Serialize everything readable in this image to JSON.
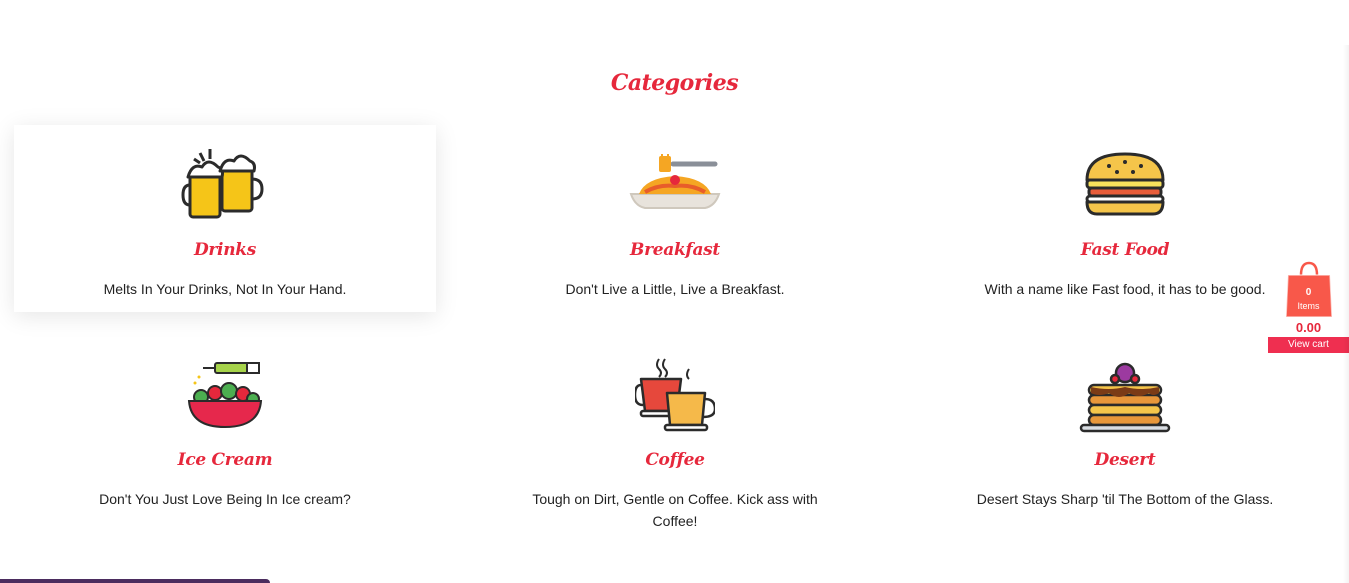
{
  "section": {
    "title": "Categories"
  },
  "categories": [
    {
      "name": "Drinks",
      "description": "Melts In Your Drinks, Not In Your Hand.",
      "icon": "beer-mugs-icon"
    },
    {
      "name": "Breakfast",
      "description": "Don't Live a Little, Live a Breakfast.",
      "icon": "pasta-plate-icon"
    },
    {
      "name": "Fast Food",
      "description": "With a name like Fast food, it has to be good.",
      "icon": "burger-icon"
    },
    {
      "name": "Ice Cream",
      "description": "Don't You Just Love Being In Ice cream?",
      "icon": "salad-bowl-icon"
    },
    {
      "name": "Coffee",
      "description": "Tough on Dirt, Gentle on Coffee. Kick ass with Coffee!",
      "icon": "coffee-cups-icon"
    },
    {
      "name": "Desert",
      "description": "Desert Stays Sharp 'til The Bottom of the Glass.",
      "icon": "pancakes-icon"
    }
  ],
  "cart": {
    "count": "0",
    "count_label": "Items",
    "total": "0.00",
    "view_label": "View cart",
    "icon": "shopping-bag-icon"
  },
  "colors": {
    "accent": "#e6283c",
    "cart_bag": "#f8584a",
    "view_cart_bg": "#ef2f50"
  }
}
